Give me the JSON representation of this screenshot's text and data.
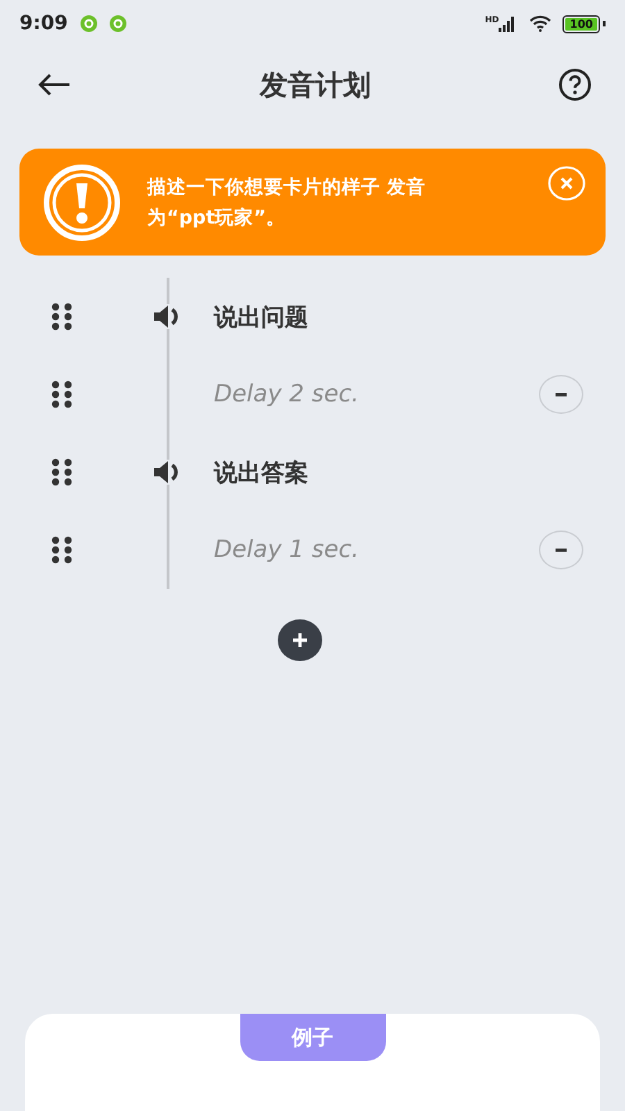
{
  "status_bar": {
    "time": "9:09",
    "network": "HD",
    "battery": "100"
  },
  "header": {
    "title": "发音计划"
  },
  "alert": {
    "message": "描述一下你想要卡片的样子 发音为“ppt玩家”。"
  },
  "steps": [
    {
      "kind": "speech",
      "label": "说出问题"
    },
    {
      "kind": "delay",
      "label": "Delay 2 sec."
    },
    {
      "kind": "speech",
      "label": "说出答案"
    },
    {
      "kind": "delay",
      "label": "Delay 1 sec."
    }
  ],
  "example_card": {
    "tab_label": "例子"
  }
}
